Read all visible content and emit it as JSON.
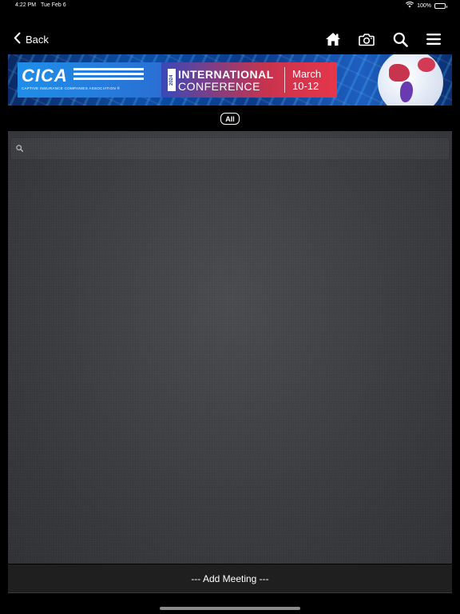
{
  "status_bar": {
    "time": "4:22 PM",
    "date": "Tue Feb 6",
    "battery": "100%"
  },
  "nav": {
    "back_label": "Back",
    "icons": [
      "home-icon",
      "camera-icon",
      "search-icon",
      "menu-icon"
    ]
  },
  "banner": {
    "org": "CICA",
    "org_full": "CAPTIVE INSURANCE COMPANIES ASSOCIATION ®",
    "year": "2024",
    "title_line1": "INTERNATIONAL",
    "title_line2": "CONFERENCE",
    "date_line1": "March",
    "date_line2": "10-12"
  },
  "filter": {
    "all_label": "All"
  },
  "search": {
    "placeholder": "",
    "value": ""
  },
  "footer": {
    "add_meeting_label": "--- Add Meeting ---"
  },
  "colors": {
    "background": "#000000",
    "panel": "#3b3d40",
    "footer_bar": "#1f1f1f",
    "accent_blue": "#1f8ee8",
    "accent_red": "#e5364a"
  }
}
